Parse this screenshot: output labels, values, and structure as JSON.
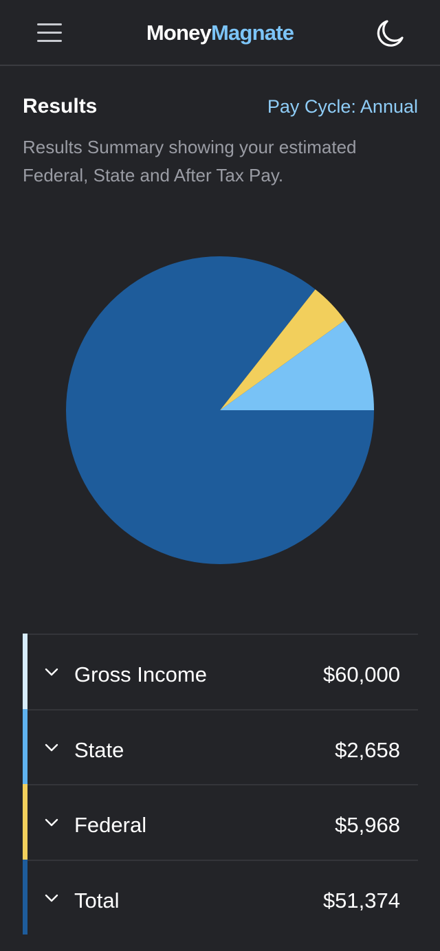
{
  "header": {
    "logo_part1": "Money",
    "logo_part2": "Magnate",
    "menu_icon": "hamburger-menu-icon",
    "theme_icon": "moon-icon"
  },
  "results": {
    "title": "Results",
    "pay_cycle": "Pay Cycle: Annual",
    "summary": "Results Summary showing your estimated Federal, State and After Tax Pay."
  },
  "chart_data": {
    "type": "pie",
    "slices": [
      {
        "label": "Total",
        "value": 51374,
        "color": "#1e5c9b"
      },
      {
        "label": "State",
        "value": 2658,
        "color": "#f2cf5c"
      },
      {
        "label": "Federal",
        "value": 5968,
        "color": "#78c2f6"
      }
    ]
  },
  "breakdown": [
    {
      "label": "Gross Income",
      "value": "$60,000",
      "color": "#d7ecfb"
    },
    {
      "label": "State",
      "value": "$2,658",
      "color": "#5fb2ef"
    },
    {
      "label": "Federal",
      "value": "$5,968",
      "color": "#f2cf5c"
    },
    {
      "label": "Total",
      "value": "$51,374",
      "color": "#1e5c9b"
    }
  ]
}
